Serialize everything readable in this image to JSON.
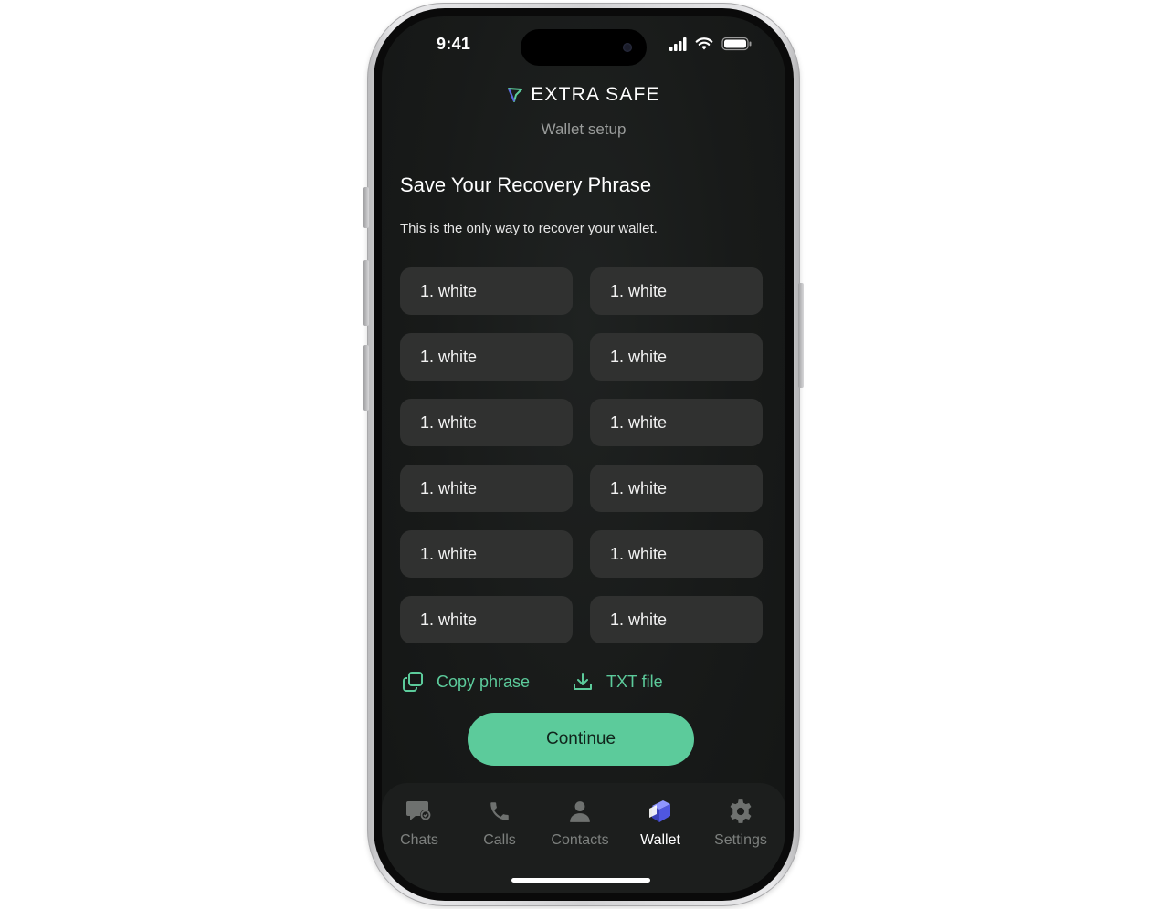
{
  "status": {
    "time": "9:41"
  },
  "header": {
    "brand": "EXTRA SAFE",
    "subtitle": "Wallet setup"
  },
  "main": {
    "title": "Save Your Recovery Phrase",
    "description": "This is the only way to recover your wallet.",
    "words": [
      "1. white",
      "1. white",
      "1. white",
      "1. white",
      "1. white",
      "1. white",
      "1. white",
      "1. white",
      "1. white",
      "1. white",
      "1. white",
      "1. white"
    ],
    "copy_label": "Copy phrase",
    "txt_label": "TXT file",
    "continue_label": "Continue"
  },
  "tabs": [
    {
      "label": "Chats",
      "icon": "chat-icon",
      "active": false
    },
    {
      "label": "Calls",
      "icon": "phone-icon",
      "active": false
    },
    {
      "label": "Contacts",
      "icon": "person-icon",
      "active": false
    },
    {
      "label": "Wallet",
      "icon": "wallet-icon",
      "active": true
    },
    {
      "label": "Settings",
      "icon": "gear-icon",
      "active": false
    }
  ],
  "colors": {
    "accent": "#5ccb9b",
    "background": "#181a19",
    "tile": "#303130",
    "wallet_icon": "#5a63e6"
  }
}
